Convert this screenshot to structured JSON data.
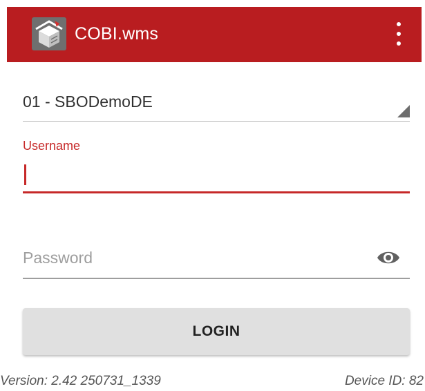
{
  "appbar": {
    "title": "COBI.wms",
    "app_icon": "warehouse-box-icon",
    "menu_icon": "more-vert-icon",
    "color": "#b91d20"
  },
  "form": {
    "database": {
      "selected": "01 - SBODemoDE"
    },
    "username": {
      "label": "Username",
      "value": ""
    },
    "password": {
      "placeholder": "Password",
      "value": "",
      "toggle_icon": "eye-icon"
    },
    "login_label": "LOGIN"
  },
  "footer": {
    "version": "Version: 2.42 250731_1339",
    "device_id": "Device ID: 82"
  }
}
